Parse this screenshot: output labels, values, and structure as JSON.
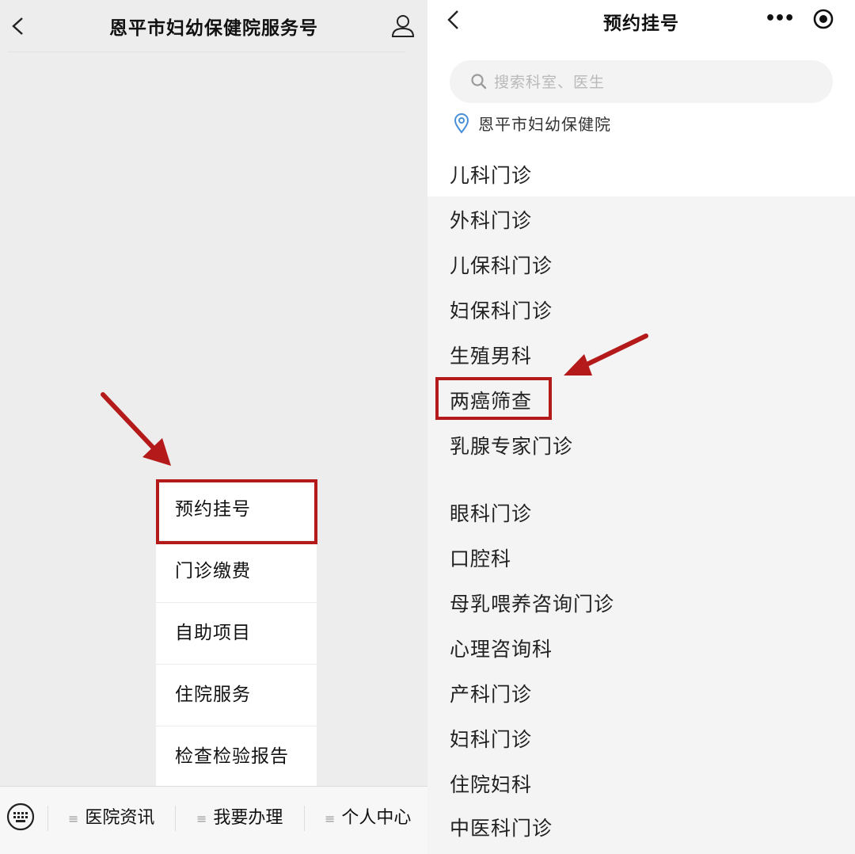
{
  "left": {
    "title": "恩平市妇幼保健院服务号",
    "menu": [
      "预约挂号",
      "门诊缴费",
      "自助项目",
      "住院服务",
      "检查检验报告"
    ],
    "tabs": [
      "医院资讯",
      "我要办理",
      "个人中心"
    ],
    "tab_glyph": "≡"
  },
  "right": {
    "title": "预约挂号",
    "search_placeholder": "搜索科室、医生",
    "location": "恩平市妇幼保健院",
    "departments": [
      "儿科门诊",
      "外科门诊",
      "儿保科门诊",
      "妇保科门诊",
      "生殖男科",
      "两癌筛查",
      "乳腺专家门诊",
      "眼科门诊",
      "口腔科",
      "母乳喂养咨询门诊",
      "心理咨询科",
      "产科门诊",
      "妇科门诊",
      "住院妇科",
      "中医科门诊"
    ]
  },
  "colors": {
    "highlight": "#b51a1a",
    "location_icon": "#4a90d9"
  }
}
